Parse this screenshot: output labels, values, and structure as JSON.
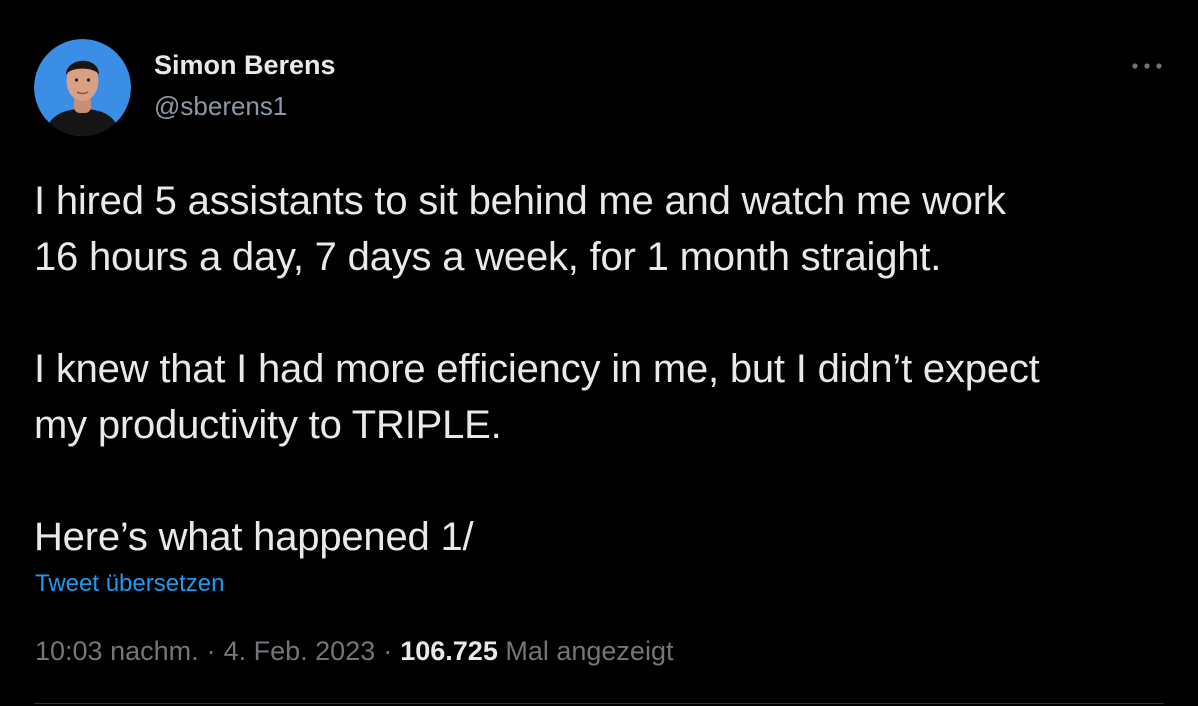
{
  "author": {
    "name": "Simon Berens",
    "handle": "@sberens1"
  },
  "tweet": {
    "paragraphs": [
      [
        "I hired 5 assistants to sit behind me and watch me work",
        "16 hours a day, 7 days a week, for 1 month straight."
      ],
      [
        "I knew that I had more efficiency in me, but I didn’t expect",
        "my productivity to TRIPLE."
      ],
      [
        "Here’s what happened 1/"
      ]
    ],
    "translate_label": "Tweet übersetzen"
  },
  "meta": {
    "time": "10:03 nachm.",
    "separator": "·",
    "date": "4. Feb. 2023",
    "views_count": "106.725",
    "views_label": "Mal angezeigt"
  },
  "icons": {
    "more": "more-horizontal-icon"
  },
  "colors": {
    "background": "#000000",
    "text": "#e7e9ea",
    "secondary_text": "#71767b",
    "link": "#1d9bf0",
    "avatar_bg": "#3a8ee6"
  }
}
